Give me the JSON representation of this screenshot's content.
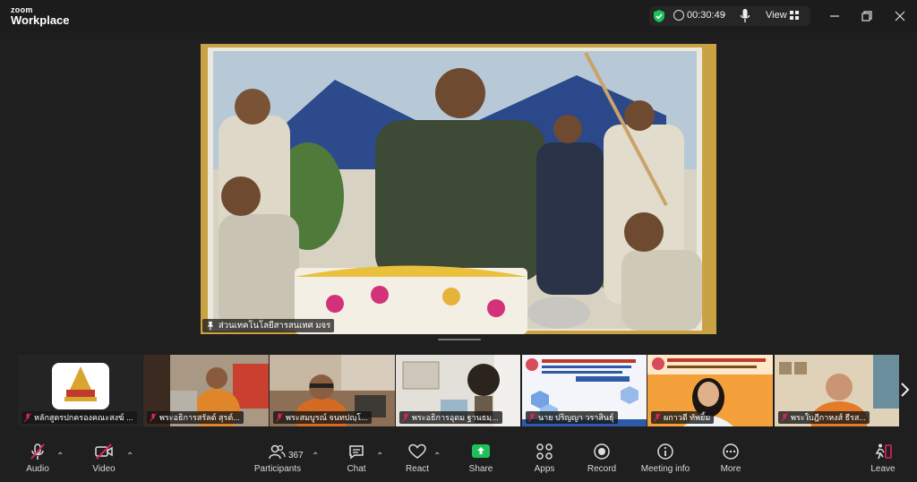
{
  "app": {
    "logo_top": "zoom",
    "logo_bottom": "Workplace"
  },
  "status": {
    "timer": "00:30:49",
    "view_label": "View"
  },
  "main_video": {
    "speaker_name": "ส่วนเทคโนโลยีสารสนเทศ มจร"
  },
  "gallery": [
    {
      "name": "หลักสูตรปกครองคณะสงฆ์ ..."
    },
    {
      "name": "พระอธิการสรัลต์ สุรต์..."
    },
    {
      "name": "พระสมบูรณ์ จนทปญฺโ..."
    },
    {
      "name": "พระอธิการอุดม ฐานธมฺ..."
    },
    {
      "name": "นาย ปริญญา วราสินธุ์"
    },
    {
      "name": "ผกาวดี ทัพยิ้ม"
    },
    {
      "name": "พระใบฎีกาหงส์ ธีรส..."
    }
  ],
  "toolbar": {
    "audio": "Audio",
    "video": "Video",
    "participants": "Participants",
    "participants_count": "367",
    "chat": "Chat",
    "react": "React",
    "share": "Share",
    "apps": "Apps",
    "record": "Record",
    "meeting_info": "Meeting info",
    "more": "More",
    "leave": "Leave"
  },
  "colors": {
    "accent_green": "#1fbf5b",
    "mute_red": "#e0245e",
    "background": "#1f1f1f"
  }
}
